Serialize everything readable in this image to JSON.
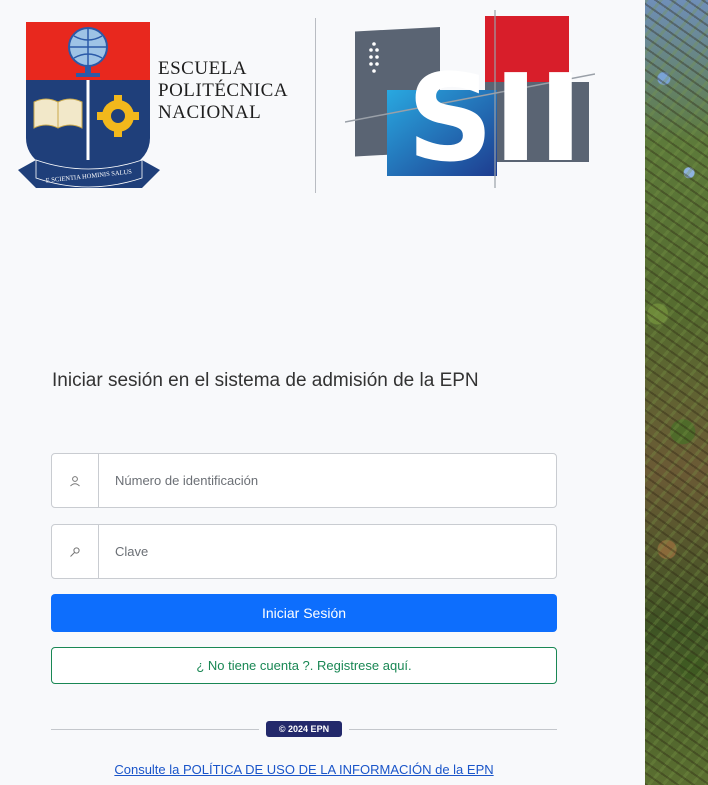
{
  "header": {
    "institution_lines": [
      "ESCUELA",
      "POLITÉCNICA",
      "NACIONAL"
    ],
    "seal_motto": "E SCIENTIA HOMINIS SALUS",
    "system_logo_text": "SII"
  },
  "login": {
    "heading": "Iniciar sesión en el sistema de admisión de la EPN",
    "id_field": {
      "placeholder": "Número de identificación",
      "value": "",
      "icon": "user-icon"
    },
    "password_field": {
      "placeholder": "Clave",
      "value": "",
      "icon": "key-icon"
    },
    "login_button": "Iniciar Sesión",
    "register_button": "¿ No tiene cuenta ?. Registrese aquí."
  },
  "footer": {
    "copyright": "© 2024 EPN",
    "policy_link": "Consulte la POLÍTICA DE USO DE LA INFORMACIÓN de la EPN"
  },
  "colors": {
    "primary": "#0d6efd",
    "success": "#198754",
    "badge": "#23296b",
    "link": "#1a55c9"
  }
}
